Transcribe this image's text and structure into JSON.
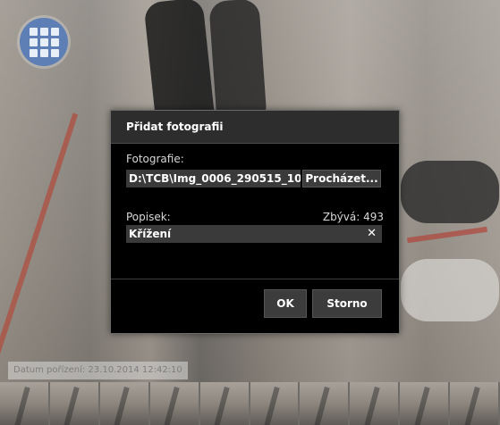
{
  "apps_button": {
    "icon": "apps-grid-icon"
  },
  "dialog": {
    "title": "Přidat fotografii",
    "photo_label": "Fotografie:",
    "photo_path": "D:\\TCB\\Img_0006_290515_10",
    "browse_button": "Procházet...",
    "caption_label": "Popisek:",
    "remaining": "Zbývá: 493",
    "caption_value": "Křížení",
    "clear_icon": "✕",
    "ok_button": "OK",
    "cancel_button": "Storno"
  },
  "capture_date": "Datum pořízení: 23.10.2014 12:42:10",
  "filmstrip": {
    "thumbnails": 10
  }
}
